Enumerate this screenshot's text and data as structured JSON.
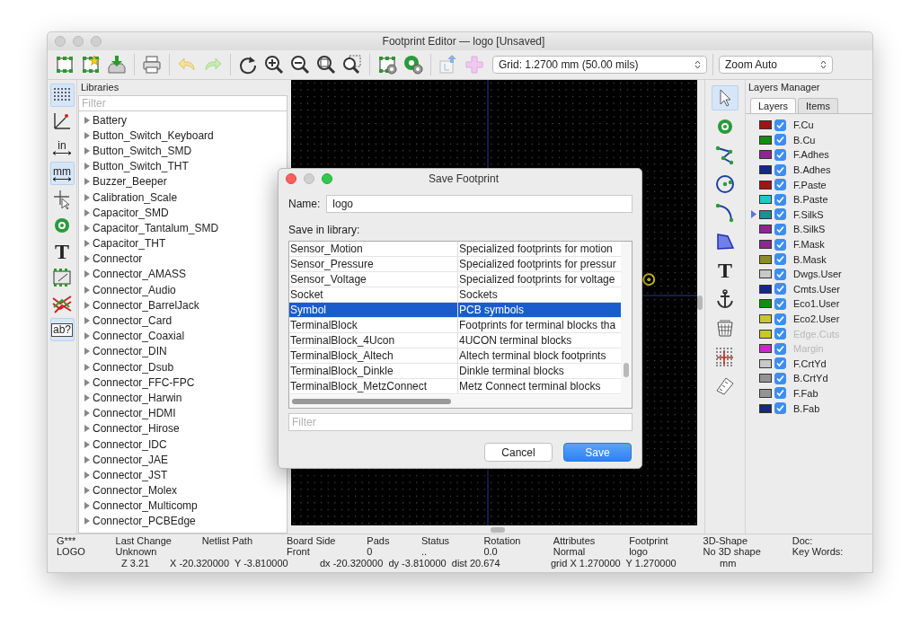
{
  "window": {
    "title": "Footprint Editor — logo [Unsaved]"
  },
  "toolbar": {
    "grid": "Grid: 1.2700 mm (50.00 mils)",
    "zoom": "Zoom Auto"
  },
  "left_toolbar": [
    {
      "kind": "grid",
      "selected": true
    },
    {
      "kind": "polar",
      "selected": false
    },
    {
      "kind": "units",
      "label": "in",
      "selected": false
    },
    {
      "kind": "units",
      "label": "mm",
      "selected": true
    },
    {
      "kind": "cursor",
      "selected": false
    },
    {
      "kind": "pad",
      "selected": false
    },
    {
      "kind": "text",
      "label": "T",
      "selected": false
    },
    {
      "kind": "footprint",
      "selected": false
    },
    {
      "kind": "ratsnest",
      "selected": false
    },
    {
      "kind": "boxed",
      "label": "ab?",
      "selected": true
    }
  ],
  "libraries": {
    "title": "Libraries",
    "filter_placeholder": "Filter",
    "items": [
      {
        "name": "Battery",
        "expanded": false
      },
      {
        "name": "Button_Switch_Keyboard",
        "expanded": false
      },
      {
        "name": "Button_Switch_SMD",
        "expanded": false
      },
      {
        "name": "Button_Switch_THT",
        "expanded": false
      },
      {
        "name": "Buzzer_Beeper",
        "expanded": false
      },
      {
        "name": "Calibration_Scale",
        "expanded": false
      },
      {
        "name": "Capacitor_SMD",
        "expanded": false
      },
      {
        "name": "Capacitor_Tantalum_SMD",
        "expanded": false
      },
      {
        "name": "Capacitor_THT",
        "expanded": false
      },
      {
        "name": "Connector",
        "expanded": false
      },
      {
        "name": "Connector_AMASS",
        "expanded": false
      },
      {
        "name": "Connector_Audio",
        "expanded": false
      },
      {
        "name": "Connector_BarrelJack",
        "expanded": false
      },
      {
        "name": "Connector_Card",
        "expanded": false
      },
      {
        "name": "Connector_Coaxial",
        "expanded": false
      },
      {
        "name": "Connector_DIN",
        "expanded": false
      },
      {
        "name": "Connector_Dsub",
        "expanded": false
      },
      {
        "name": "Connector_FFC-FPC",
        "expanded": false
      },
      {
        "name": "Connector_Harwin",
        "expanded": false
      },
      {
        "name": "Connector_HDMI",
        "expanded": false
      },
      {
        "name": "Connector_Hirose",
        "expanded": false
      },
      {
        "name": "Connector_IDC",
        "expanded": false
      },
      {
        "name": "Connector_JAE",
        "expanded": false
      },
      {
        "name": "Connector_JST",
        "expanded": false
      },
      {
        "name": "Connector_Molex",
        "expanded": false
      },
      {
        "name": "Connector_Multicomp",
        "expanded": false
      },
      {
        "name": "Connector_PCBEdge",
        "expanded": false
      }
    ]
  },
  "right_toolbar": [
    {
      "kind": "select",
      "selected": true
    },
    {
      "kind": "pad",
      "selected": false
    },
    {
      "kind": "polyline",
      "selected": false
    },
    {
      "kind": "circle",
      "selected": false
    },
    {
      "kind": "arc",
      "selected": false
    },
    {
      "kind": "polygon",
      "selected": false
    },
    {
      "kind": "text",
      "label": "T",
      "selected": false
    },
    {
      "kind": "anchor",
      "selected": false
    },
    {
      "kind": "delete",
      "selected": false
    },
    {
      "kind": "origin",
      "selected": false
    },
    {
      "kind": "measure",
      "selected": false
    }
  ],
  "layers": {
    "title": "Layers Manager",
    "tabs": [
      {
        "label": "Layers",
        "selected": true
      },
      {
        "label": "Items",
        "selected": false
      }
    ],
    "items": [
      {
        "name": "F.Cu",
        "color": "#a01414",
        "checked": true,
        "disabled": false,
        "selected": false
      },
      {
        "name": "B.Cu",
        "color": "#148c14",
        "checked": true,
        "disabled": false,
        "selected": false
      },
      {
        "name": "F.Adhes",
        "color": "#8c2890",
        "checked": true,
        "disabled": false,
        "selected": false
      },
      {
        "name": "B.Adhes",
        "color": "#142884",
        "checked": true,
        "disabled": false,
        "selected": false
      },
      {
        "name": "F.Paste",
        "color": "#a01414",
        "checked": true,
        "disabled": false,
        "selected": false
      },
      {
        "name": "B.Paste",
        "color": "#20c8c8",
        "checked": true,
        "disabled": false,
        "selected": false
      },
      {
        "name": "F.SilkS",
        "color": "#149494",
        "checked": true,
        "disabled": false,
        "selected": true
      },
      {
        "name": "B.SilkS",
        "color": "#8c2890",
        "checked": true,
        "disabled": false,
        "selected": false
      },
      {
        "name": "F.Mask",
        "color": "#8c2890",
        "checked": true,
        "disabled": false,
        "selected": false
      },
      {
        "name": "B.Mask",
        "color": "#8c8c28",
        "checked": true,
        "disabled": false,
        "selected": false
      },
      {
        "name": "Dwgs.User",
        "color": "#c8c8c8",
        "checked": true,
        "disabled": false,
        "selected": false
      },
      {
        "name": "Cmts.User",
        "color": "#142884",
        "checked": true,
        "disabled": false,
        "selected": false
      },
      {
        "name": "Eco1.User",
        "color": "#148c14",
        "checked": true,
        "disabled": false,
        "selected": false
      },
      {
        "name": "Eco2.User",
        "color": "#c8c828",
        "checked": true,
        "disabled": false,
        "selected": false
      },
      {
        "name": "Edge.Cuts",
        "color": "#c8c828",
        "checked": true,
        "disabled": true,
        "selected": false
      },
      {
        "name": "Margin",
        "color": "#c828c8",
        "checked": true,
        "disabled": true,
        "selected": false
      },
      {
        "name": "F.CrtYd",
        "color": "#c8c8c8",
        "checked": true,
        "disabled": false,
        "selected": false
      },
      {
        "name": "B.CrtYd",
        "color": "#949494",
        "checked": true,
        "disabled": false,
        "selected": false
      },
      {
        "name": "F.Fab",
        "color": "#949494",
        "checked": true,
        "disabled": false,
        "selected": false
      },
      {
        "name": "B.Fab",
        "color": "#142884",
        "checked": true,
        "disabled": false,
        "selected": false
      }
    ]
  },
  "status": {
    "columns": [
      {
        "label": "G***",
        "value": "LOGO"
      },
      {
        "label": "Last Change",
        "value": "Unknown"
      },
      {
        "label": "Netlist Path"
      },
      {
        "label": "Board Side",
        "value": "Front"
      },
      {
        "label": "Pads",
        "value": "0"
      },
      {
        "label": "Status",
        "value": ".."
      },
      {
        "label": "Rotation",
        "value": "0.0"
      },
      {
        "label": "Attributes",
        "value": "Normal"
      },
      {
        "label": "Footprint",
        "value": "logo"
      },
      {
        "label": "3D-Shape",
        "value": "No 3D shape"
      },
      {
        "label": "Doc:",
        "value": "Key Words:"
      }
    ],
    "coords": [
      "Z 3.21",
      "X -20.320000  Y -3.810000",
      "dx -20.320000  dy -3.810000  dist 20.674",
      "grid X 1.270000  Y 1.270000",
      "mm"
    ]
  },
  "dialog": {
    "title": "Save Footprint",
    "name_label": "Name:",
    "name_value": "logo",
    "library_label": "Save in library:",
    "rows": [
      {
        "name": "Sensor_Motion",
        "description": "Specialized footprints for motion",
        "selected": false
      },
      {
        "name": "Sensor_Pressure",
        "description": "Specialized footprints for pressur",
        "selected": false
      },
      {
        "name": "Sensor_Voltage",
        "description": "Specialized footprints for voltage",
        "selected": false
      },
      {
        "name": "Socket",
        "description": "Sockets",
        "selected": false
      },
      {
        "name": "Symbol",
        "description": "PCB symbols",
        "selected": true
      },
      {
        "name": "TerminalBlock",
        "description": "Footprints for terminal blocks tha",
        "selected": false
      },
      {
        "name": "TerminalBlock_4Ucon",
        "description": "4UCON terminal blocks",
        "selected": false
      },
      {
        "name": "TerminalBlock_Altech",
        "description": "Altech terminal block footprints",
        "selected": false
      },
      {
        "name": "TerminalBlock_Dinkle",
        "description": "Dinkle terminal blocks",
        "selected": false
      },
      {
        "name": "TerminalBlock_MetzConnect",
        "description": "Metz Connect terminal blocks",
        "selected": false
      }
    ],
    "filter_placeholder": "Filter",
    "buttons": [
      {
        "label": "Cancel",
        "kind": "secondary"
      },
      {
        "label": "Save",
        "kind": "primary"
      }
    ]
  }
}
